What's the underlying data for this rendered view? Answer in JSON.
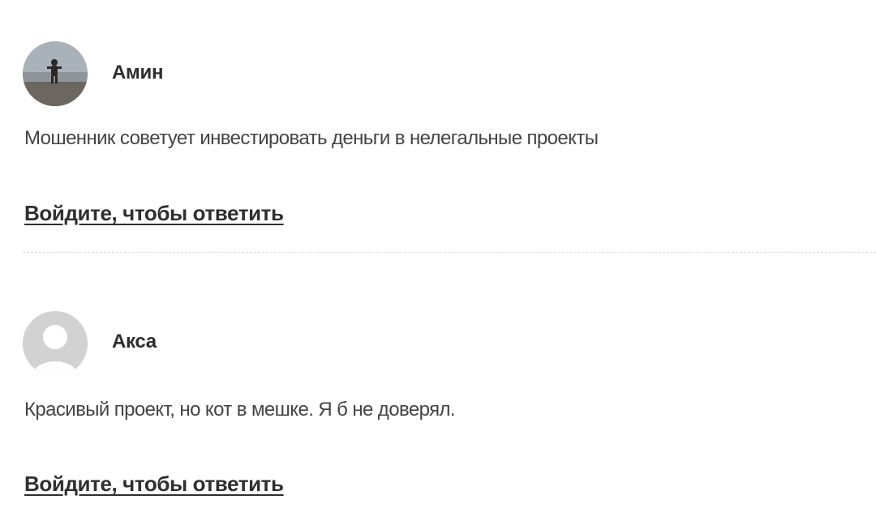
{
  "comments": [
    {
      "author": "Амин",
      "avatar": "user-photo-avatar",
      "text": "Мошенник советует инвестировать деньги в нелегальные проекты",
      "reply_label": "Войдите, чтобы ответить"
    },
    {
      "author": "Акса",
      "avatar": "default-user-avatar-icon",
      "text": "Красивый проект, но кот в мешке. Я б не доверял.",
      "reply_label": "Войдите, чтобы ответить"
    }
  ],
  "colors": {
    "text": "#333333",
    "link": "#2f2f2f",
    "avatar_placeholder": "#d2d2d2",
    "divider": "#dcdcdc"
  }
}
